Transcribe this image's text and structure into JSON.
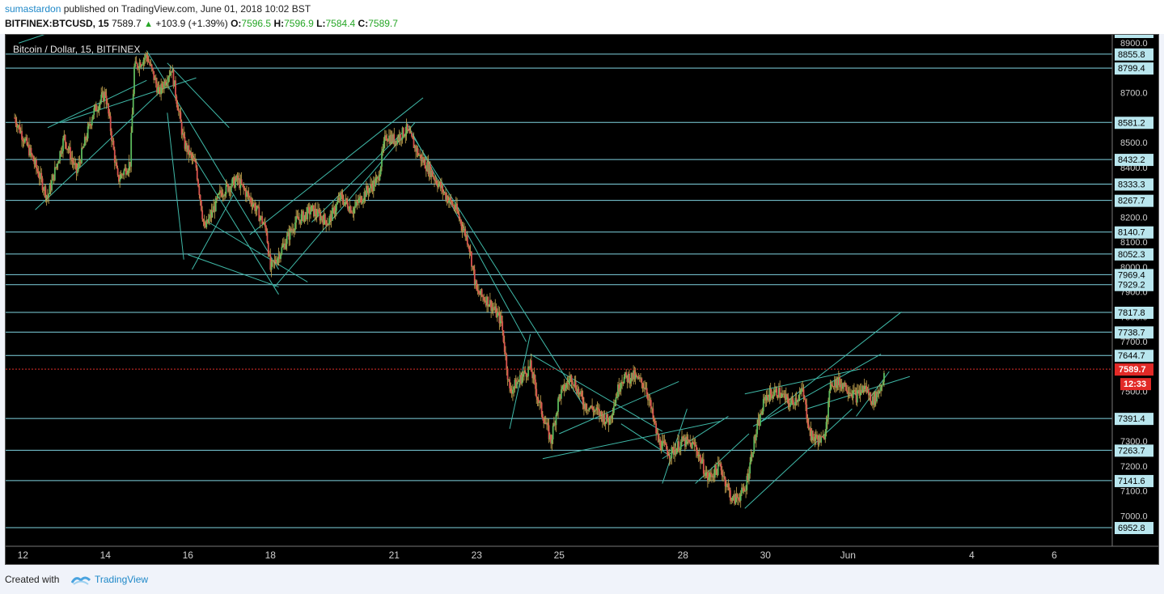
{
  "header": {
    "author": "sumastardon",
    "published_text": " published on TradingView.com, June 01, 2018 10:02 BST",
    "symbol": "BITFINEX:BTCUSD, 15",
    "last": "7589.7",
    "arrow": "▲",
    "change": "+103.9 (+1.39%)",
    "open_label": "O:",
    "open": "7596.5",
    "high_label": "H:",
    "high": "7596.9",
    "low_label": "L:",
    "low": "7584.4",
    "close_label": "C:",
    "close": "7589.7"
  },
  "chart_data": {
    "type": "candlestick",
    "title": "Bitcoin / Dollar, 15, BITFINEX",
    "ylim": [
      6930,
      8960
    ],
    "y_ticks": [
      "7000.0",
      "7100.0",
      "7200.0",
      "7300.0",
      "7500.0",
      "7700.0",
      "7800.0",
      "7900.0",
      "8000.0",
      "8100.0",
      "8200.0",
      "8400.0",
      "8500.0",
      "8700.0",
      "8900.0"
    ],
    "x_ticks": [
      {
        "label": "12",
        "day": 12
      },
      {
        "label": "14",
        "day": 14
      },
      {
        "label": "16",
        "day": 16
      },
      {
        "label": "18",
        "day": 18
      },
      {
        "label": "21",
        "day": 21
      },
      {
        "label": "23",
        "day": 23
      },
      {
        "label": "25",
        "day": 25
      },
      {
        "label": "28",
        "day": 28
      },
      {
        "label": "30",
        "day": 30
      },
      {
        "label": "Jun",
        "day": 32
      },
      {
        "label": "4",
        "day": 35
      },
      {
        "label": "6",
        "day": 37
      }
    ],
    "support_resistance_levels": [
      8855.8,
      8799.4,
      8581.2,
      8432.2,
      8333.3,
      8267.7,
      8140.7,
      8052.3,
      7969.4,
      7929.2,
      7817.8,
      7738.7,
      7644.7,
      7391.4,
      7263.7,
      7141.6,
      6952.8
    ],
    "current_price": 7589.7,
    "countdown": "12:33",
    "price_path": [
      [
        11.8,
        8600
      ],
      [
        12.2,
        8450
      ],
      [
        12.6,
        8280
      ],
      [
        13.0,
        8520
      ],
      [
        13.3,
        8380
      ],
      [
        13.7,
        8620
      ],
      [
        14.0,
        8700
      ],
      [
        14.3,
        8350
      ],
      [
        14.6,
        8420
      ],
      [
        14.7,
        8800
      ],
      [
        15.0,
        8850
      ],
      [
        15.3,
        8700
      ],
      [
        15.6,
        8800
      ],
      [
        15.9,
        8500
      ],
      [
        16.2,
        8400
      ],
      [
        16.4,
        8150
      ],
      [
        16.8,
        8300
      ],
      [
        17.2,
        8350
      ],
      [
        17.6,
        8250
      ],
      [
        17.9,
        8150
      ],
      [
        18.0,
        7990
      ],
      [
        18.3,
        8080
      ],
      [
        18.6,
        8180
      ],
      [
        19.0,
        8230
      ],
      [
        19.4,
        8180
      ],
      [
        19.7,
        8280
      ],
      [
        20.0,
        8230
      ],
      [
        20.3,
        8300
      ],
      [
        20.6,
        8350
      ],
      [
        20.8,
        8530
      ],
      [
        21.0,
        8510
      ],
      [
        21.3,
        8550
      ],
      [
        21.6,
        8450
      ],
      [
        21.9,
        8380
      ],
      [
        22.2,
        8300
      ],
      [
        22.5,
        8230
      ],
      [
        22.8,
        8100
      ],
      [
        23.0,
        7900
      ],
      [
        23.3,
        7860
      ],
      [
        23.6,
        7780
      ],
      [
        23.8,
        7500
      ],
      [
        24.1,
        7560
      ],
      [
        24.3,
        7600
      ],
      [
        24.5,
        7460
      ],
      [
        24.8,
        7300
      ],
      [
        25.0,
        7480
      ],
      [
        25.3,
        7560
      ],
      [
        25.6,
        7450
      ],
      [
        25.9,
        7420
      ],
      [
        26.2,
        7380
      ],
      [
        26.5,
        7550
      ],
      [
        26.8,
        7560
      ],
      [
        27.1,
        7520
      ],
      [
        27.4,
        7300
      ],
      [
        27.7,
        7250
      ],
      [
        28.0,
        7300
      ],
      [
        28.3,
        7280
      ],
      [
        28.6,
        7150
      ],
      [
        28.9,
        7200
      ],
      [
        29.2,
        7060
      ],
      [
        29.5,
        7100
      ],
      [
        29.7,
        7280
      ],
      [
        30.0,
        7480
      ],
      [
        30.3,
        7500
      ],
      [
        30.6,
        7450
      ],
      [
        30.9,
        7500
      ],
      [
        31.1,
        7320
      ],
      [
        31.4,
        7300
      ],
      [
        31.6,
        7540
      ],
      [
        31.9,
        7530
      ],
      [
        32.2,
        7480
      ],
      [
        32.4,
        7520
      ],
      [
        32.6,
        7460
      ],
      [
        32.8,
        7520
      ],
      [
        32.9,
        7589.7
      ]
    ],
    "trendlines": [
      [
        [
          11.9,
          8900
        ],
        [
          15.5,
          9100
        ]
      ],
      [
        [
          12.3,
          8230
        ],
        [
          15.3,
          8700
        ]
      ],
      [
        [
          12.9,
          8580
        ],
        [
          16.2,
          8760
        ]
      ],
      [
        [
          12.6,
          8560
        ],
        [
          15.0,
          8750
        ]
      ],
      [
        [
          15.5,
          8820
        ],
        [
          17.0,
          8560
        ]
      ],
      [
        [
          15.0,
          8870
        ],
        [
          18.2,
          7990
        ]
      ],
      [
        [
          16.0,
          8480
        ],
        [
          18.2,
          7890
        ]
      ],
      [
        [
          15.5,
          8620
        ],
        [
          15.9,
          8030
        ]
      ],
      [
        [
          16.1,
          7990
        ],
        [
          17.1,
          8290
        ]
      ],
      [
        [
          16.0,
          8050
        ],
        [
          18.2,
          7920
        ]
      ],
      [
        [
          16.5,
          8180
        ],
        [
          18.9,
          7940
        ]
      ],
      [
        [
          18.1,
          7920
        ],
        [
          21.5,
          8580
        ]
      ],
      [
        [
          17.5,
          8130
        ],
        [
          21.7,
          8680
        ]
      ],
      [
        [
          19.0,
          8180
        ],
        [
          21.2,
          8540
        ]
      ],
      [
        [
          21.3,
          8580
        ],
        [
          24.2,
          7700
        ]
      ],
      [
        [
          21.4,
          8540
        ],
        [
          25.6,
          7440
        ]
      ],
      [
        [
          24.3,
          7650
        ],
        [
          27.5,
          7340
        ]
      ],
      [
        [
          23.8,
          7350
        ],
        [
          24.3,
          7730
        ]
      ],
      [
        [
          24.6,
          7230
        ],
        [
          28.9,
          7380
        ]
      ],
      [
        [
          25.0,
          7330
        ],
        [
          27.9,
          7540
        ]
      ],
      [
        [
          26.5,
          7370
        ],
        [
          27.7,
          7240
        ]
      ],
      [
        [
          27.5,
          7230
        ],
        [
          29.1,
          7400
        ]
      ],
      [
        [
          27.5,
          7130
        ],
        [
          28.1,
          7430
        ]
      ],
      [
        [
          28.3,
          7130
        ],
        [
          29.6,
          7330
        ]
      ],
      [
        [
          29.5,
          7030
        ],
        [
          32.1,
          7430
        ]
      ],
      [
        [
          29.5,
          7490
        ],
        [
          32.3,
          7590
        ]
      ],
      [
        [
          29.7,
          7360
        ],
        [
          32.8,
          7650
        ]
      ],
      [
        [
          29.9,
          7380
        ],
        [
          33.3,
          7820
        ]
      ],
      [
        [
          31.0,
          7430
        ],
        [
          33.5,
          7560
        ]
      ],
      [
        [
          32.2,
          7400
        ],
        [
          33.0,
          7580
        ]
      ]
    ]
  }
}
